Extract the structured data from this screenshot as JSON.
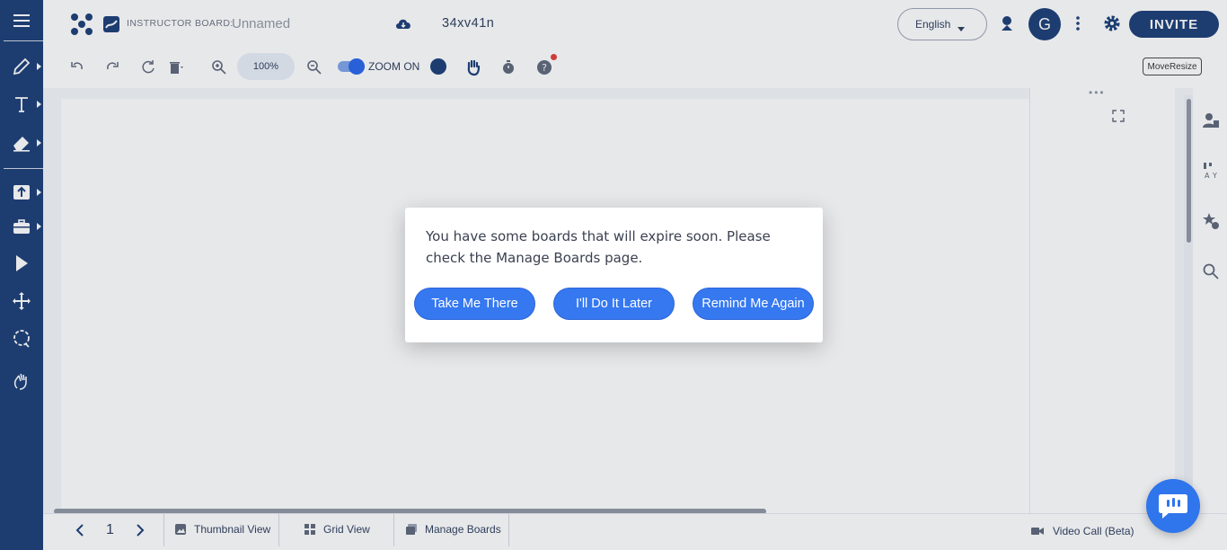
{
  "header": {
    "board_label": "INSTRUCTOR BOARD:",
    "board_name": "Unnamed",
    "board_code": "34xv41n",
    "language": "English",
    "avatar_initial": "G",
    "invite_label": "INVITE"
  },
  "toolbar": {
    "zoom_percent": "100%",
    "zoom_toggle_label": "ZOOM ON",
    "move_resize_label": "MoveResize"
  },
  "bottom_bar": {
    "page_number": "1",
    "thumbnail_view": "Thumbnail View",
    "grid_view": "Grid View",
    "manage_boards": "Manage Boards",
    "video_call": "Video Call (Beta)"
  },
  "dialog": {
    "message": "You have some boards that will expire soon. Please check the Manage Boards page.",
    "buttons": [
      {
        "label": "Take Me There"
      },
      {
        "label": "I'll Do It Later"
      },
      {
        "label": "Remind Me Again"
      }
    ]
  },
  "icons": {
    "left_bar": [
      "menu-icon",
      "pencil-icon",
      "text-icon",
      "eraser-icon",
      "upload-icon",
      "toolbox-icon",
      "pointer-icon",
      "move-icon",
      "lasso-icon",
      "hand-wave-icon"
    ],
    "toolbar": [
      "undo-icon",
      "redo-icon",
      "refresh-icon",
      "trash-icon",
      "zoom-in-icon",
      "zoom-out-icon",
      "color-icon",
      "hand-icon",
      "timer-icon",
      "help-icon"
    ],
    "right_col": [
      "user-list-icon",
      "translate-icon",
      "star-settings-icon",
      "search-icon"
    ]
  },
  "colors": {
    "brand_navy": "#173b74",
    "dialog_button": "#3578f0",
    "chat_bubble": "#2f75ec"
  }
}
